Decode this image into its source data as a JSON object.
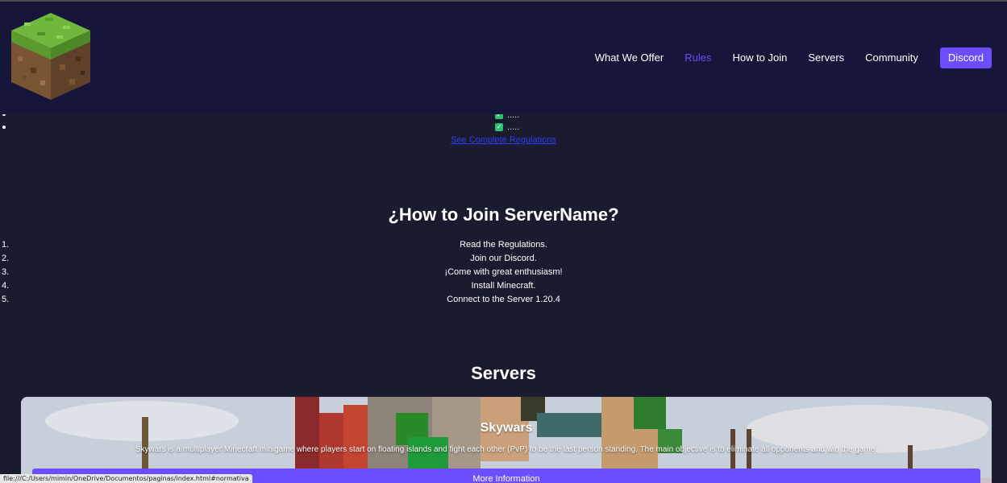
{
  "header": {
    "logo_icon": "grass-block-icon",
    "nav": [
      {
        "label": "What We Offer",
        "active": false
      },
      {
        "label": "Rules",
        "active": true
      },
      {
        "label": "How to Join",
        "active": false
      },
      {
        "label": "Servers",
        "active": false
      },
      {
        "label": "Community",
        "active": false
      }
    ],
    "discord_label": "Discord"
  },
  "rules": {
    "items": [
      ".....",
      "....."
    ],
    "link_label": "See Complete Regulations"
  },
  "join": {
    "title": "¿How to Join ServerName?",
    "steps": [
      {
        "num": "1.",
        "text": "Read the Regulations."
      },
      {
        "num": "2.",
        "text": "Join our Discord."
      },
      {
        "num": "3.",
        "text": "¡Come with great enthusiasm!"
      },
      {
        "num": "4.",
        "text": "Install Minecraft."
      },
      {
        "num": "5.",
        "text": "Connect to the Server 1.20.4"
      }
    ]
  },
  "servers": {
    "title": "Servers",
    "card": {
      "title": "Skywars",
      "description": "Skywars is a multiplayer Minecraft minigame where players start on floating islands and fight each other (PvP) to be the last person standing. The main objective is to eliminate all opponents and win the game.",
      "button_label": "More Information"
    }
  },
  "status_url": "file:///C:/Users/mimin/OneDrive/Documentos/paginas/index.html#normativa",
  "colors": {
    "header_bg": "#15163a",
    "page_bg": "#1a1b2e",
    "accent": "#6c4dff",
    "link": "#2a3cff",
    "check": "#2fbf71"
  }
}
